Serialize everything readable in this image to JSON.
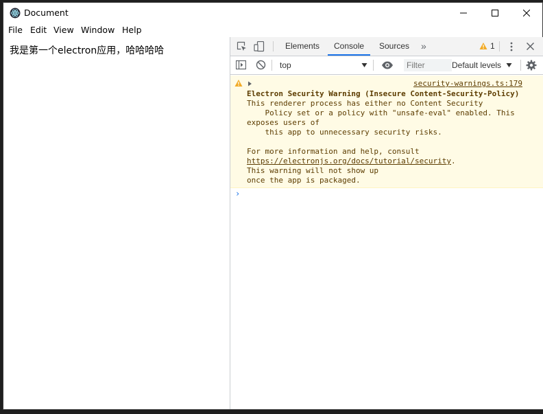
{
  "window": {
    "title": "Document",
    "icon": "electron-logo-icon",
    "controls": [
      "minimize",
      "maximize",
      "close"
    ]
  },
  "menu": {
    "items": [
      "File",
      "Edit",
      "View",
      "Window",
      "Help"
    ]
  },
  "page": {
    "text": "我是第一个electron应用，哈哈哈哈"
  },
  "devtools": {
    "tabs": [
      "Elements",
      "Console",
      "Sources"
    ],
    "active_tab": "Console",
    "more_tabs_glyph": "»",
    "warning_count": "1",
    "console_toolbar": {
      "context": "top",
      "filter_placeholder": "Filter",
      "levels": "Default levels"
    },
    "message": {
      "level": "warning",
      "source": "security-warnings.ts:179",
      "title": "Electron Security Warning (Insecure Content-Security-Policy)",
      "body_lines": [
        "This renderer process has either no Content Security",
        "    Policy set or a policy with \"unsafe-eval\" enabled. This",
        "exposes users of",
        "    this app to unnecessary security risks.",
        "",
        "For more information and help, consult"
      ],
      "link": "https://electronjs.org/docs/tutorial/security",
      "link_suffix": ".",
      "tail_lines": [
        "This warning will not show up",
        "once the app is packaged."
      ]
    },
    "prompt_glyph": "›"
  },
  "colors": {
    "accent": "#1a73e8",
    "warning_bg": "#fffbe5",
    "warning_text": "#5c3c00",
    "warning_icon": "#f2ab26"
  }
}
